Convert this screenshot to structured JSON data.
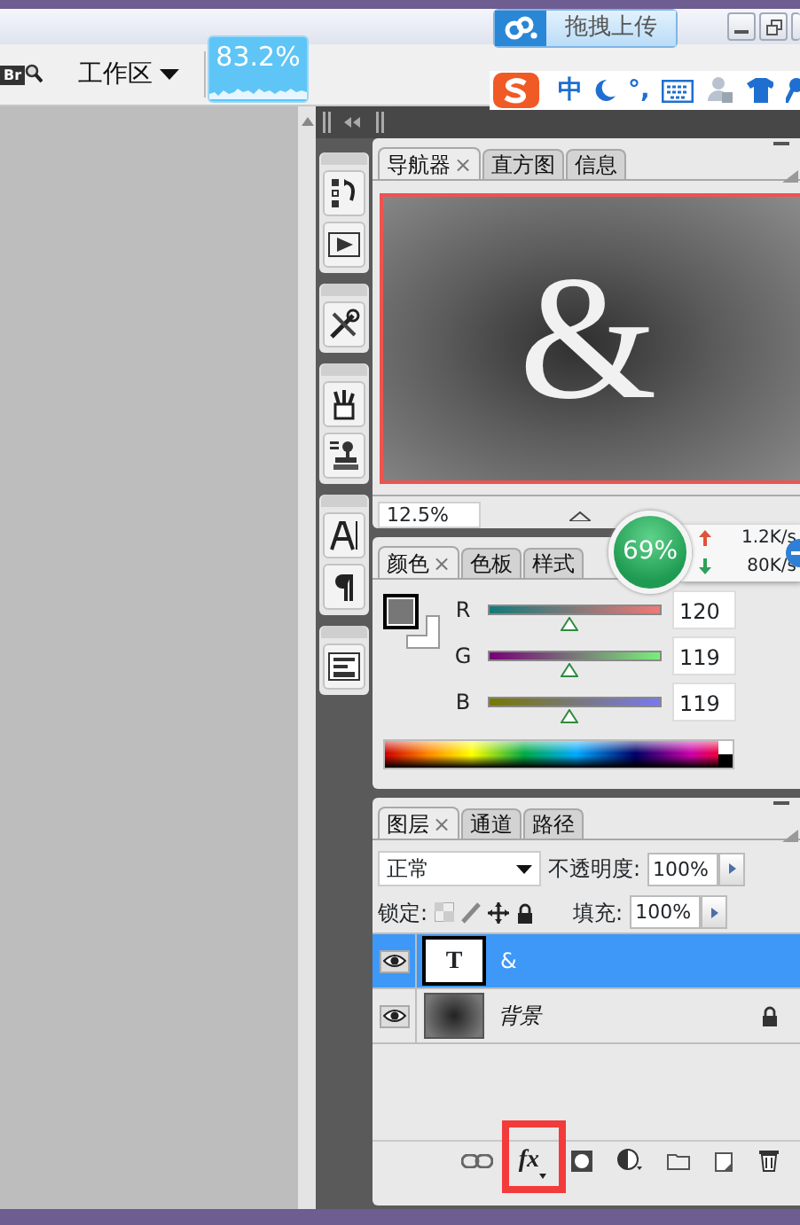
{
  "title_bar": {
    "upload_button": "拖拽上传"
  },
  "options_bar": {
    "bridge_label": "Br",
    "workspace_menu": "工作区"
  },
  "cpu_widget": {
    "reading": "83.2%"
  },
  "ime_bar": {
    "mode": "中",
    "punctuation": "°,"
  },
  "navigator": {
    "tabs": [
      {
        "label": "导航器",
        "close": "×",
        "selected": true
      },
      {
        "label": "直方图",
        "selected": false
      },
      {
        "label": "信息",
        "selected": false
      }
    ],
    "canvas_text": "&",
    "zoom": "12.5%"
  },
  "network_widget": {
    "percent": "69%",
    "upload": "1.2K/s",
    "download": "80K/s"
  },
  "color": {
    "tabs": [
      {
        "label": "颜色",
        "close": "×",
        "selected": true
      },
      {
        "label": "色板",
        "selected": false
      },
      {
        "label": "样式",
        "selected": false
      }
    ],
    "channels": [
      {
        "name": "R",
        "value": "120",
        "level": 0.47
      },
      {
        "name": "G",
        "value": "119",
        "level": 0.47
      },
      {
        "name": "B",
        "value": "119",
        "level": 0.47
      }
    ]
  },
  "layers": {
    "tabs": [
      {
        "label": "图层",
        "close": "×",
        "selected": true
      },
      {
        "label": "通道",
        "selected": false
      },
      {
        "label": "路径",
        "selected": false
      }
    ],
    "blend_mode": "正常",
    "opacity_label": "不透明度:",
    "opacity": "100%",
    "lock_label": "锁定:",
    "fill_label": "填充:",
    "fill": "100%",
    "items": [
      {
        "kind": "text",
        "thumb_text": "T",
        "name": "&",
        "visible": true,
        "selected": true,
        "locked": false
      },
      {
        "kind": "image",
        "name": "背景",
        "visible": true,
        "selected": false,
        "locked": true
      }
    ],
    "fx_button": {
      "label": "fx",
      "highlighted": true
    }
  }
}
